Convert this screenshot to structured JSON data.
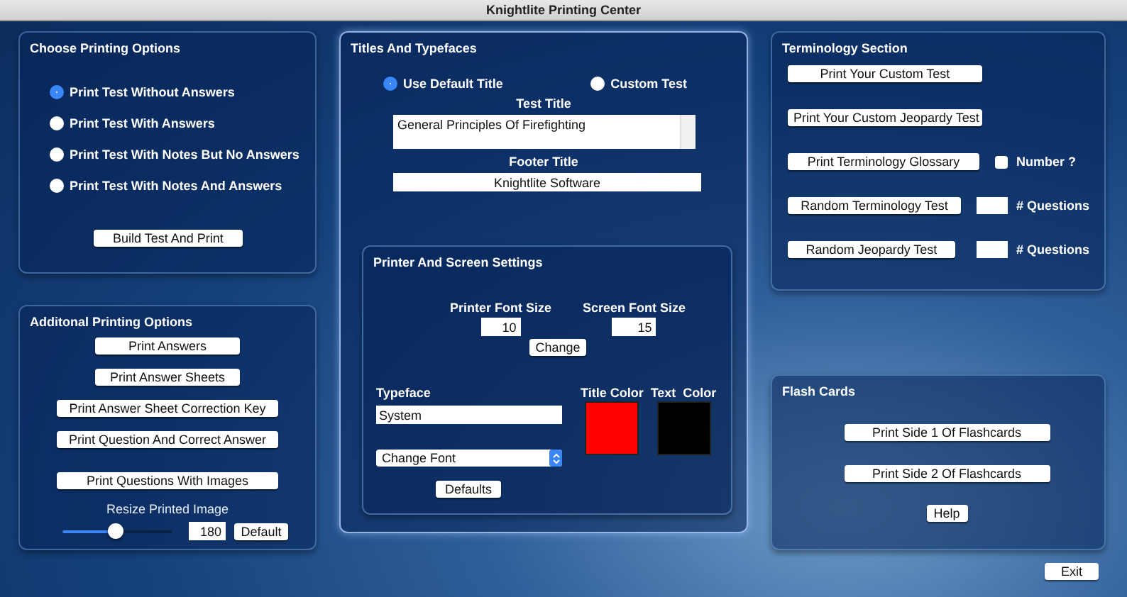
{
  "window": {
    "title": "Knightlite Printing Center"
  },
  "print_options": {
    "title": "Choose Printing Options",
    "options": [
      {
        "label": "Print Test Without Answers",
        "selected": true
      },
      {
        "label": "Print Test With Answers",
        "selected": false
      },
      {
        "label": "Print Test With Notes But No Answers",
        "selected": false
      },
      {
        "label": "Print Test With Notes And Answers",
        "selected": false
      }
    ],
    "build_button": "Build Test And Print"
  },
  "additional_options": {
    "title": "Additonal Printing Options",
    "buttons": [
      {
        "label": "Print Answers",
        "kind": "narrow"
      },
      {
        "label": "Print Answer Sheets",
        "kind": "narrow"
      },
      {
        "label": "Print Answer Sheet Correction Key",
        "kind": "wide"
      },
      {
        "label": "Print Question And Correct Answer",
        "kind": "wide"
      },
      {
        "label": "Print Questions With Images",
        "kind": "wide"
      }
    ],
    "resize": {
      "label": "Resize Printed Image",
      "level": 0.45,
      "value": "180",
      "default_button": "Default"
    }
  },
  "titles": {
    "title": "Titles And Typefaces",
    "title_modes": [
      {
        "label": "Use Default Title",
        "selected": true
      },
      {
        "label": "Custom Test",
        "selected": false
      }
    ],
    "test_title_label": "Test Title",
    "test_title_value": "General Principles Of Firefighting",
    "footer_label": "Footer Title",
    "footer_value": "Knightlite Software"
  },
  "printer_settings": {
    "title": "Printer And Screen Settings",
    "printer_font_size_label": "Printer Font Size",
    "printer_font_size": "10",
    "screen_font_size_label": "Screen Font Size",
    "screen_font_size": "15",
    "change_button": "Change",
    "typeface_label": "Typeface",
    "typeface_value": "System",
    "font_select": "Change Font",
    "defaults_button": "Defaults",
    "swatches": [
      {
        "label": "Title Color",
        "color": "#ff0000"
      },
      {
        "label": "Text  Color",
        "color": "#000000"
      }
    ]
  },
  "terminology": {
    "title": "Terminology Section",
    "rows": [
      {
        "kind": "button",
        "button": "Print Your Custom Test"
      },
      {
        "kind": "button",
        "button": "Print Your Custom Jeopardy Test"
      },
      {
        "kind": "checkbox",
        "button": "Print Terminology Glossary",
        "label": "Number ?",
        "checked": false
      },
      {
        "kind": "count",
        "button": "Random Terminology Test",
        "label": "# Questions"
      },
      {
        "kind": "count",
        "button": "Random Jeopardy Test",
        "label": "# Questions"
      }
    ]
  },
  "flash_cards": {
    "title": "Flash Cards",
    "buttons": [
      "Print Side 1 Of Flashcards",
      "Print Side 2 Of Flashcards"
    ],
    "help_button": "Help"
  },
  "exit_button": "Exit"
}
